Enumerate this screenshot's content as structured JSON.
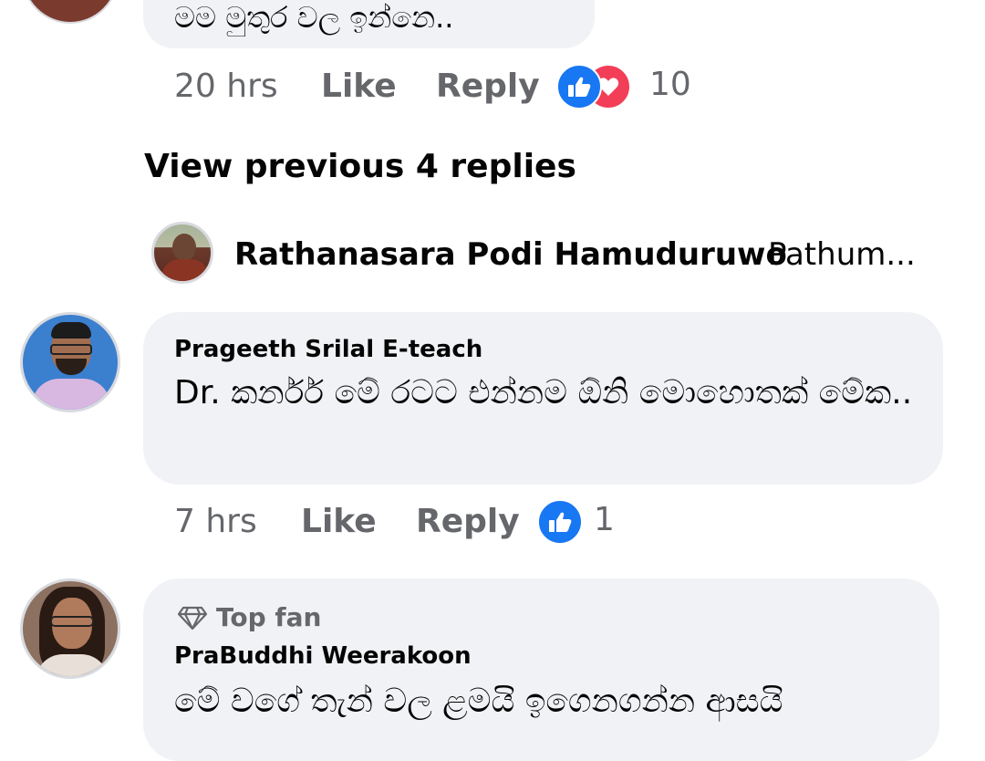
{
  "comments": [
    {
      "text": "මම මුතුර වල ඉන්නෙ..",
      "time": "20 hrs",
      "like_label": "Like",
      "reply_label": "Reply",
      "reactions": [
        "like-icon",
        "love-icon"
      ],
      "reaction_count": "10"
    },
    {
      "author": "Prageeth Srilal E-teach",
      "text": "Dr. කර්නර් මේ රටට එන්නම ඕනි මොහොතක් මේක..",
      "time": "7 hrs",
      "like_label": "Like",
      "reply_label": "Reply",
      "reactions": [
        "like-icon"
      ],
      "reaction_count": "1"
    },
    {
      "badge": "Top fan",
      "author": "PraBuddhi Weerakoon",
      "text": "මේ වගේ තැන් වල ළමයි ඉගෙනගන්න ආසයි"
    }
  ],
  "view_previous_label": "View previous 4 replies",
  "reply_preview": {
    "author": "Rathanasara Podi Hamuduruwo",
    "snippet": "Pathum..."
  },
  "colors": {
    "bubble": "#f0f2f5",
    "meta_text": "#65676b",
    "like_blue": "#1877f2",
    "love_red": "#f33e58"
  }
}
